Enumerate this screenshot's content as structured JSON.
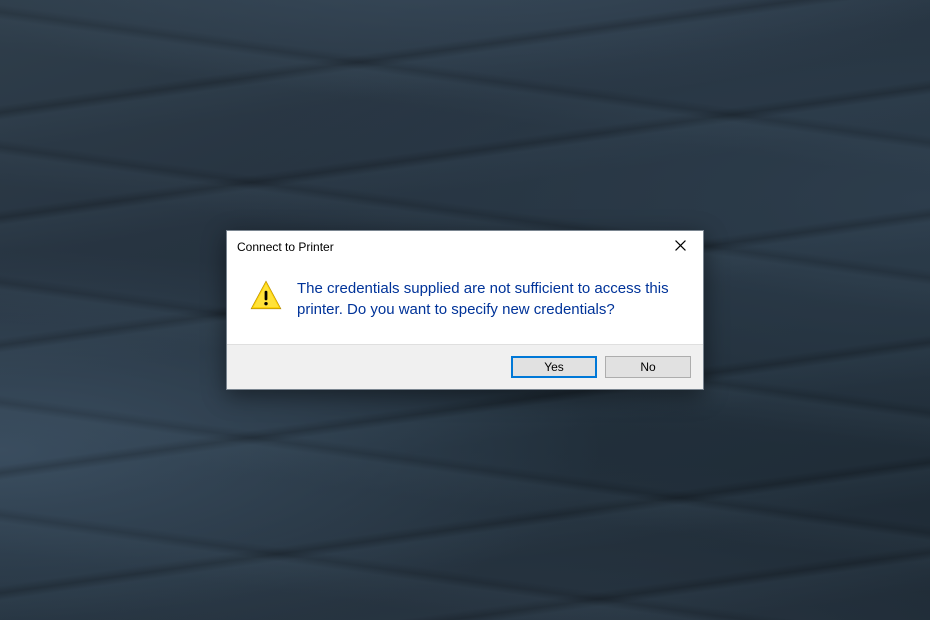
{
  "dialog": {
    "title": "Connect to Printer",
    "icon": "warning-icon",
    "message": "The credentials supplied are not sufficient to access this printer. Do you want to specify new credentials?",
    "buttons": {
      "yes": "Yes",
      "no": "No"
    }
  }
}
